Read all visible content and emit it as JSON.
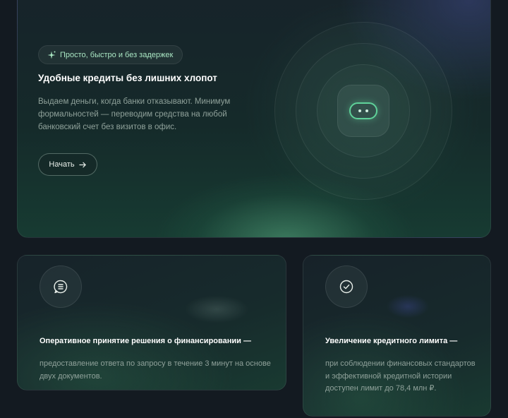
{
  "hero": {
    "badge_icon": "sparkle-icon",
    "badge_text": "Просто, быстро и без задержек",
    "title": "Удобные кредиты без лишних хлопот",
    "description": "Выдаем деньги, когда банки отказывают. Минимум формальностей — переводим средства на любой банковский счет без визитов в офис.",
    "start_label": "Начать",
    "start_icon": "arrow-right-icon",
    "illustration_icon": "chat-bubble-icon"
  },
  "features": [
    {
      "icon": "message-list-icon",
      "title": "Оперативное принятие решения о финансировании —",
      "text": "предоставление ответа по запросу в течение 3 минут на основе двух документов."
    },
    {
      "icon": "check-circle-icon",
      "title": "Увеличение кредитного лимита —",
      "text": "при соблюдении финансовых стандартов и эффективной кредитной истории доступен лимит до 78,4 млн ₽."
    }
  ],
  "colors": {
    "background": "#131a21",
    "accent_green": "#5fd29a",
    "badge_text": "#a9e6c3",
    "muted_text": "#8fa19a"
  }
}
